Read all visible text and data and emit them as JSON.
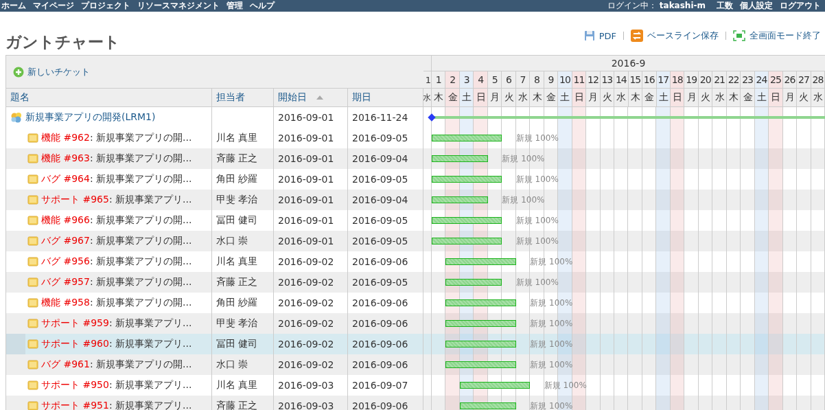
{
  "top_menu": {
    "items": [
      "ホーム",
      "マイページ",
      "プロジェクト",
      "リソースマネジメント",
      "管理",
      "ヘルプ"
    ],
    "login_label": "ログイン中：",
    "user": "takashi-m",
    "account_items": [
      "工数",
      "個人設定",
      "ログアウト"
    ]
  },
  "page_title": "ガントチャート",
  "actions": [
    {
      "kind": "pdf",
      "label": "PDF"
    },
    {
      "kind": "baseline",
      "label": "ベースライン保存"
    },
    {
      "kind": "fullscreen",
      "label": "全画面モード終了"
    }
  ],
  "new_ticket": "新しいチケット",
  "columns": [
    {
      "label": "題名",
      "sorted": false
    },
    {
      "label": "担当者",
      "sorted": false
    },
    {
      "label": "開始日",
      "sorted": true
    },
    {
      "label": "期日",
      "sorted": false
    }
  ],
  "month": "2016-9",
  "partial_day": {
    "day": "1",
    "weekday": "水"
  },
  "days": [
    {
      "day": "1",
      "weekday": "木",
      "kind": "weekday"
    },
    {
      "day": "2",
      "weekday": "金",
      "kind": "holiday"
    },
    {
      "day": "3",
      "weekday": "土",
      "kind": "saturday"
    },
    {
      "day": "4",
      "weekday": "日",
      "kind": "holiday"
    },
    {
      "day": "5",
      "weekday": "月",
      "kind": "weekday"
    },
    {
      "day": "6",
      "weekday": "火",
      "kind": "weekday"
    },
    {
      "day": "7",
      "weekday": "水",
      "kind": "weekday"
    },
    {
      "day": "8",
      "weekday": "木",
      "kind": "weekday"
    },
    {
      "day": "9",
      "weekday": "金",
      "kind": "weekday"
    },
    {
      "day": "10",
      "weekday": "土",
      "kind": "saturday"
    },
    {
      "day": "11",
      "weekday": "日",
      "kind": "holiday"
    },
    {
      "day": "12",
      "weekday": "月",
      "kind": "weekday"
    },
    {
      "day": "13",
      "weekday": "火",
      "kind": "weekday"
    },
    {
      "day": "14",
      "weekday": "水",
      "kind": "weekday"
    },
    {
      "day": "15",
      "weekday": "木",
      "kind": "weekday"
    },
    {
      "day": "16",
      "weekday": "金",
      "kind": "weekday"
    },
    {
      "day": "17",
      "weekday": "土",
      "kind": "saturday"
    },
    {
      "day": "18",
      "weekday": "日",
      "kind": "holiday"
    },
    {
      "day": "19",
      "weekday": "月",
      "kind": "weekday"
    },
    {
      "day": "20",
      "weekday": "火",
      "kind": "weekday"
    },
    {
      "day": "21",
      "weekday": "水",
      "kind": "weekday"
    },
    {
      "day": "22",
      "weekday": "木",
      "kind": "weekday"
    },
    {
      "day": "23",
      "weekday": "金",
      "kind": "weekday"
    },
    {
      "day": "24",
      "weekday": "土",
      "kind": "saturday"
    },
    {
      "day": "25",
      "weekday": "日",
      "kind": "holiday"
    },
    {
      "day": "26",
      "weekday": "月",
      "kind": "weekday"
    },
    {
      "day": "27",
      "weekday": "火",
      "kind": "weekday"
    },
    {
      "day": "28",
      "weekday": "水",
      "kind": "weekday"
    }
  ],
  "project": {
    "name": "新規事業アプリの開発(LRM1)",
    "start": "2016-09-01",
    "due": "2016-11-24",
    "children": [
      {
        "tracker": "機能",
        "number": "#962",
        "title": ": 新規事業アプリの開...",
        "assignee": "川名 真里",
        "start": "2016-09-01",
        "due": "2016-09-05",
        "status": "新規 100%",
        "selected": false
      },
      {
        "tracker": "機能",
        "number": "#963",
        "title": ": 新規事業アプリの開...",
        "assignee": "斉藤 正之",
        "start": "2016-09-01",
        "due": "2016-09-04",
        "status": "新規 100%",
        "selected": false
      },
      {
        "tracker": "バグ",
        "number": "#964",
        "title": ": 新規事業アプリの開...",
        "assignee": "角田 紗羅",
        "start": "2016-09-01",
        "due": "2016-09-05",
        "status": "新規 100%",
        "selected": false
      },
      {
        "tracker": "サポート",
        "number": "#965",
        "title": ": 新規事業アプリ...",
        "assignee": "甲斐 孝治",
        "start": "2016-09-01",
        "due": "2016-09-04",
        "status": "新規 100%",
        "selected": false
      },
      {
        "tracker": "機能",
        "number": "#966",
        "title": ": 新規事業アプリの開...",
        "assignee": "冨田 健司",
        "start": "2016-09-01",
        "due": "2016-09-05",
        "status": "新規 100%",
        "selected": false
      },
      {
        "tracker": "バグ",
        "number": "#967",
        "title": ": 新規事業アプリの開...",
        "assignee": "水口 崇",
        "start": "2016-09-01",
        "due": "2016-09-05",
        "status": "新規 100%",
        "selected": false
      },
      {
        "tracker": "バグ",
        "number": "#956",
        "title": ": 新規事業アプリの開...",
        "assignee": "川名 真里",
        "start": "2016-09-02",
        "due": "2016-09-06",
        "status": "新規 100%",
        "selected": false
      },
      {
        "tracker": "バグ",
        "number": "#957",
        "title": ": 新規事業アプリの開...",
        "assignee": "斉藤 正之",
        "start": "2016-09-02",
        "due": "2016-09-05",
        "status": "新規 100%",
        "selected": false
      },
      {
        "tracker": "機能",
        "number": "#958",
        "title": ": 新規事業アプリの開...",
        "assignee": "角田 紗羅",
        "start": "2016-09-02",
        "due": "2016-09-06",
        "status": "新規 100%",
        "selected": false
      },
      {
        "tracker": "サポート",
        "number": "#959",
        "title": ": 新規事業アプリ...",
        "assignee": "甲斐 孝治",
        "start": "2016-09-02",
        "due": "2016-09-06",
        "status": "新規 100%",
        "selected": false
      },
      {
        "tracker": "サポート",
        "number": "#960",
        "title": ": 新規事業アプリ...",
        "assignee": "冨田 健司",
        "start": "2016-09-02",
        "due": "2016-09-06",
        "status": "新規 100%",
        "selected": true
      },
      {
        "tracker": "バグ",
        "number": "#961",
        "title": ": 新規事業アプリの開...",
        "assignee": "水口 崇",
        "start": "2016-09-02",
        "due": "2016-09-06",
        "status": "新規 100%",
        "selected": false
      },
      {
        "tracker": "サポート",
        "number": "#950",
        "title": ": 新規事業アプリ...",
        "assignee": "川名 真里",
        "start": "2016-09-03",
        "due": "2016-09-07",
        "status": "新規 100%",
        "selected": false
      },
      {
        "tracker": "サポート",
        "number": "#951",
        "title": ": 新規事業アプリ...",
        "assignee": "斉藤 正之",
        "start": "2016-09-03",
        "due": "2016-09-06",
        "status": "新規 100%",
        "selected": false
      }
    ]
  }
}
